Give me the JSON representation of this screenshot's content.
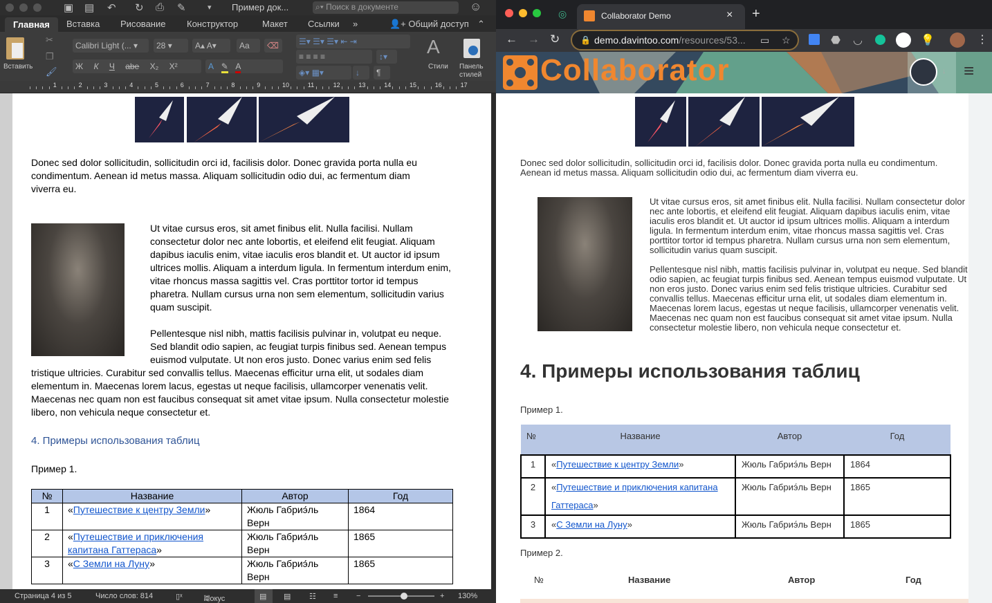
{
  "word": {
    "doc_title": "Пример док...",
    "search_placeholder": "Поиск в документе",
    "tabs": [
      "Главная",
      "Вставка",
      "Рисование",
      "Конструктор",
      "Макет",
      "Ссылки"
    ],
    "more_tabs": "»",
    "share": "Общий доступ",
    "paste": "Вставить",
    "font_name": "Calibri Light (...",
    "font_size": "28",
    "format": {
      "bold": "Ж",
      "italic": "К",
      "underline": "Ч",
      "strike": "abe",
      "sub": "X₂",
      "sup": "X²"
    },
    "styles": "Стили",
    "styles_pane_1": "Панель",
    "styles_pane_2": "стилей",
    "ruler": [
      "1",
      "2",
      "3",
      "4",
      "5",
      "6",
      "7",
      "8",
      "9",
      "10",
      "11",
      "12",
      "13",
      "14",
      "15",
      "16",
      "17"
    ],
    "status": {
      "page": "Страница 4 из 5",
      "words": "Число слов: 814",
      "focus": "Фокус",
      "zoom": "130%",
      "zoom_level": 130
    }
  },
  "content": {
    "p1": "Donec sed dolor sollicitudin, sollicitudin orci id, facilisis dolor. Donec gravida porta nulla eu condimentum. Aenean id metus massa. Aliquam sollicitudin odio dui, ac fermentum diam viverra eu.",
    "p2": "Ut vitae cursus eros, sit amet finibus elit. Nulla facilisi. Nullam consectetur dolor nec ante lobortis, et eleifend elit feugiat. Aliquam dapibus iaculis enim, vitae iaculis eros blandit et. Ut auctor id ipsum ultrices mollis. Aliquam a interdum ligula. In fermentum interdum enim, vitae rhoncus massa sagittis vel. Cras porttitor tortor id tempus pharetra. Nullam cursus urna non sem elementum, sollicitudin varius quam suscipit.",
    "p3": "Pellentesque nisl nibh, mattis facilisis pulvinar in, volutpat eu neque. Sed blandit odio sapien, ac feugiat turpis finibus sed. Aenean tempus euismod vulputate. Ut non eros justo. Donec varius enim sed felis tristique ultricies. Curabitur sed convallis tellus. Maecenas efficitur urna elit, ut sodales diam elementum in. Maecenas lorem lacus, egestas ut neque facilisis, ullamcorper venenatis velit. Maecenas nec quam non est faucibus consequat sit amet vitae ipsum. Nulla consectetur molestie libero, non vehicula neque consectetur et.",
    "heading": "4. Примеры использования таблиц",
    "example1": "Пример 1.",
    "example2": "Пример 2.",
    "headers": [
      "№",
      "Название",
      "Автор",
      "Год"
    ],
    "open_quote": "«",
    "close_quote": "»",
    "rows": [
      {
        "num": "1",
        "title": "Путешествие к центру Земли",
        "author": "Жюль Габриэ́ль Верн",
        "year": "1864"
      },
      {
        "num": "2",
        "title": "Путешествие и приключения капитана Гаттераса",
        "author": "Жюль Габриэ́ль Верн",
        "year": "1865"
      },
      {
        "num": "3",
        "title": "С Земли на Луну",
        "author": "Жюль Габриэ́ль Верн",
        "year": "1865"
      }
    ]
  },
  "browser": {
    "tab_title": "Collaborator Demo",
    "close": "×",
    "new_tab": "+",
    "url_host": "demo.davintoo.com",
    "url_path": "/resources/53...",
    "logo": "Collaborator"
  },
  "colors": {
    "table_header": "#b4c6e7",
    "link": "#1155cc",
    "brand_orange": "#f0872f",
    "row_peach": "#f8e5d8"
  }
}
